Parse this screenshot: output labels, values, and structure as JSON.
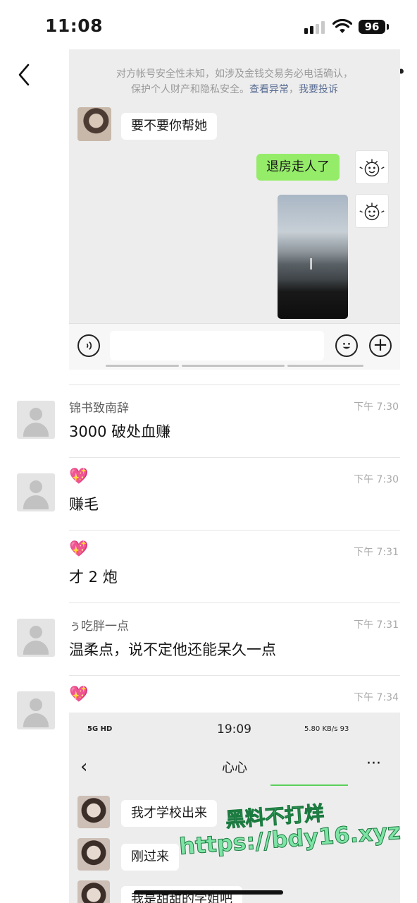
{
  "status_bar": {
    "time": "11:08",
    "battery": "96"
  },
  "shot1": {
    "security_line1": "对方帐号安全性未知，如涉及金钱交易务必电话确认，",
    "security_line2_prefix": "保护个人财产和隐私安全。",
    "security_link1": "查看异常",
    "security_sep": "，",
    "security_link2": "我要投诉",
    "msg_left": "要不要你帮她",
    "msg_right": "退房走人了"
  },
  "comments": [
    {
      "name": "锦书致南辞",
      "time": "下午 7:30",
      "text": "3000 破处血赚"
    },
    {
      "name": "💖",
      "time": "下午 7:30",
      "text": "赚毛"
    },
    {
      "name": "💖",
      "time": "下午 7:31",
      "text": "才 2 炮"
    },
    {
      "name": "ぅ吃胖一点",
      "time": "下午 7:31",
      "text": "温柔点，说不定他还能呆久一点"
    },
    {
      "name": "💖",
      "time": "下午 7:34",
      "text": ""
    }
  ],
  "shot2": {
    "sb_left": "5G HD",
    "time": "19:09",
    "sb_right": "5.80 KB/s  93",
    "title": "心心",
    "msg1": "我才学校出来",
    "msg2": "刚过来",
    "msg3": "我是甜甜的学姐吧"
  },
  "watermark": {
    "line1": "黑料不打烊",
    "line2": "https://bdy16.xyz"
  },
  "colors": {
    "bubble_green": "#95ec69",
    "link": "#5a6d94",
    "watermark": "#7ee4a6"
  }
}
